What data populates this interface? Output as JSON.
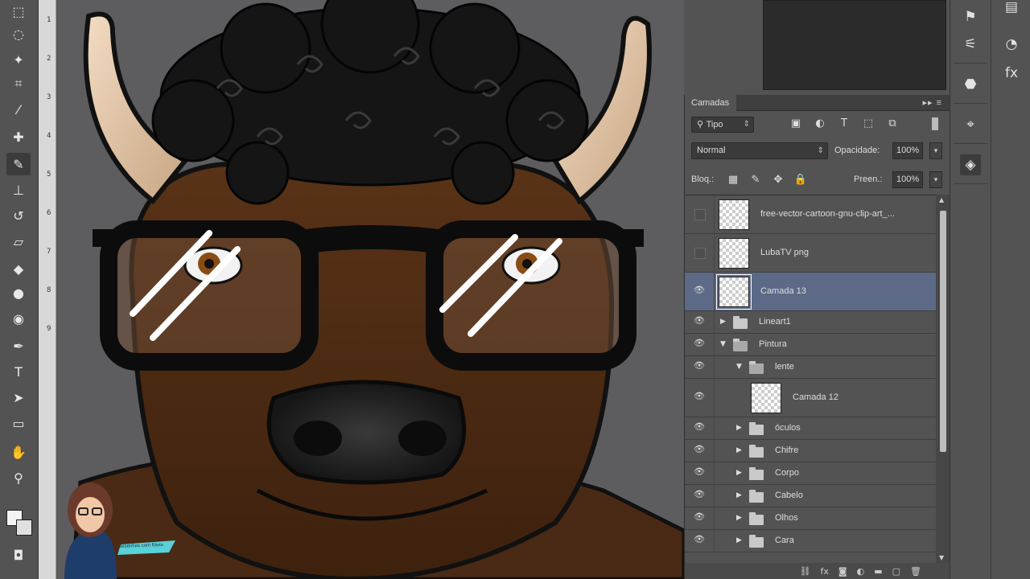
{
  "toolbar": {
    "tools": [
      {
        "name": "marquee-tool-icon",
        "glyph": "⬚"
      },
      {
        "name": "lasso-tool-icon",
        "glyph": "◌"
      },
      {
        "name": "magic-wand-tool-icon",
        "glyph": "✦"
      },
      {
        "name": "crop-tool-icon",
        "glyph": "⌗"
      },
      {
        "name": "eyedropper-tool-icon",
        "glyph": "⁄"
      },
      {
        "name": "spot-healing-tool-icon",
        "glyph": "✚"
      },
      {
        "name": "brush-tool-icon",
        "glyph": "✎"
      },
      {
        "name": "clone-stamp-tool-icon",
        "glyph": "⊥"
      },
      {
        "name": "history-brush-tool-icon",
        "glyph": "↺"
      },
      {
        "name": "eraser-tool-icon",
        "glyph": "▱"
      },
      {
        "name": "paint-bucket-tool-icon",
        "glyph": "◆"
      },
      {
        "name": "blur-tool-icon",
        "glyph": "●"
      },
      {
        "name": "dodge-tool-icon",
        "glyph": "◉"
      },
      {
        "name": "pen-tool-icon",
        "glyph": "✒"
      },
      {
        "name": "type-tool-icon",
        "glyph": "T"
      },
      {
        "name": "path-selection-tool-icon",
        "glyph": "➤"
      },
      {
        "name": "rectangle-tool-icon",
        "glyph": "▭"
      },
      {
        "name": "hand-tool-icon",
        "glyph": "✋"
      },
      {
        "name": "zoom-tool-icon",
        "glyph": "⚲"
      }
    ],
    "active_tool": "brush-tool-icon",
    "quick_mask_glyph": "◘"
  },
  "ruler": {
    "ticks": [
      "1",
      "2",
      "3",
      "4",
      "5",
      "6",
      "7",
      "8",
      "9"
    ]
  },
  "layers_panel": {
    "tab_label": "Camadas",
    "menu_glyph": "▸▸ ≡",
    "filter": {
      "kind_label": "Tipo",
      "icons": [
        "image-filter-icon",
        "adjustment-filter-icon",
        "type-filter-icon",
        "shape-filter-icon",
        "smart-object-filter-icon"
      ],
      "icon_glyphs": [
        "▣",
        "◐",
        "T",
        "⬚",
        "⧉"
      ]
    },
    "blend_mode": "Normal",
    "opacity_label": "Opacidade:",
    "opacity_value": "100%",
    "lock_label": "Bloq.:",
    "lock_icon_glyphs": [
      "▦",
      "✎",
      "✥",
      "🔒"
    ],
    "fill_label": "Preen.:",
    "fill_value": "100%",
    "layers": [
      {
        "name": "free-vector-cartoon-gnu-clip-art_...",
        "visible": false,
        "type": "layer"
      },
      {
        "name": "LubaTV png",
        "visible": false,
        "type": "layer"
      },
      {
        "name": "Camada 13",
        "visible": true,
        "type": "layer",
        "selected": true
      },
      {
        "name": "Lineart1",
        "visible": true,
        "type": "group",
        "expanded": false
      },
      {
        "name": "Pintura",
        "visible": true,
        "type": "group",
        "expanded": true
      },
      {
        "name": "lente",
        "visible": true,
        "type": "group",
        "expanded": true
      },
      {
        "name": "Camada 12",
        "visible": true,
        "type": "layer"
      },
      {
        "name": "óculos",
        "visible": true,
        "type": "group",
        "expanded": false
      },
      {
        "name": "Chifre",
        "visible": true,
        "type": "group",
        "expanded": false
      },
      {
        "name": "Corpo",
        "visible": true,
        "type": "group",
        "expanded": false
      },
      {
        "name": "Cabelo",
        "visible": true,
        "type": "group",
        "expanded": false
      },
      {
        "name": "Olhos",
        "visible": true,
        "type": "group",
        "expanded": false
      },
      {
        "name": "Cara",
        "visible": true,
        "type": "group",
        "expanded": false
      }
    ],
    "footer_icons": [
      "link-layers-icon",
      "fx-icon",
      "add-mask-icon",
      "adjustment-layer-icon",
      "new-group-icon",
      "new-layer-icon",
      "delete-layer-icon"
    ],
    "footer_glyphs": [
      "⛓",
      "fx",
      "◙",
      "◐",
      "▬",
      "▢",
      "🗑"
    ]
  },
  "dock": {
    "col1": [
      "brush-preset-icon",
      "brush-settings-icon",
      "color-icon",
      "path-icon",
      "layers-icon"
    ],
    "col1_glyphs": [
      "⚑",
      "⚟",
      "⬣",
      "⌖",
      "◈"
    ],
    "col2": [
      "swatches-icon",
      "adjustments-icon",
      "styles-icon"
    ],
    "col2_glyphs": [
      "▤",
      "◔",
      "fx"
    ]
  },
  "watermark": {
    "text": "desenhos com flávia"
  },
  "colors": {
    "ui_panel": "#535353",
    "selection": "#5d6a87",
    "canvas_bg": "#5d5d5f"
  }
}
